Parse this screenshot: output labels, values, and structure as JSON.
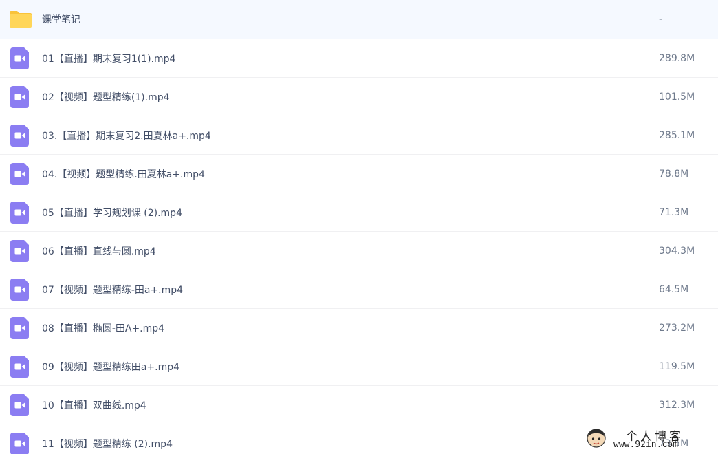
{
  "files": [
    {
      "type": "folder",
      "icon": "folder-icon",
      "name": "课堂笔记",
      "size": "-"
    },
    {
      "type": "video",
      "icon": "video-file-icon",
      "name": "01【直播】期末复习1(1).mp4",
      "size": "289.8M"
    },
    {
      "type": "video",
      "icon": "video-file-icon",
      "name": "02【视频】题型精练(1).mp4",
      "size": "101.5M"
    },
    {
      "type": "video",
      "icon": "video-file-icon",
      "name": "03.【直播】期末复习2.田夏林a+.mp4",
      "size": "285.1M"
    },
    {
      "type": "video",
      "icon": "video-file-icon",
      "name": "04.【视频】题型精练.田夏林a+.mp4",
      "size": "78.8M"
    },
    {
      "type": "video",
      "icon": "video-file-icon",
      "name": "05【直播】学习规划课 (2).mp4",
      "size": "71.3M"
    },
    {
      "type": "video",
      "icon": "video-file-icon",
      "name": "06【直播】直线与圆.mp4",
      "size": "304.3M"
    },
    {
      "type": "video",
      "icon": "video-file-icon",
      "name": "07【视频】题型精练-田a+.mp4",
      "size": "64.5M"
    },
    {
      "type": "video",
      "icon": "video-file-icon",
      "name": "08【直播】椭圆-田A+.mp4",
      "size": "273.2M"
    },
    {
      "type": "video",
      "icon": "video-file-icon",
      "name": "09【视频】题型精练田a+.mp4",
      "size": "119.5M"
    },
    {
      "type": "video",
      "icon": "video-file-icon",
      "name": "10【直播】双曲线.mp4",
      "size": "312.3M"
    },
    {
      "type": "video",
      "icon": "video-file-icon",
      "name": "11【视频】题型精练 (2).mp4",
      "size": "73.5M"
    }
  ],
  "colors": {
    "folder": "#ffd659",
    "folder_tab": "#f9c33a",
    "video": "#8b7df2",
    "row_divider": "#f0f0f2",
    "name_text": "#424e67",
    "size_text": "#6f7a8c"
  },
  "watermark": {
    "title": "个人博客",
    "url": "www.92in.com"
  }
}
